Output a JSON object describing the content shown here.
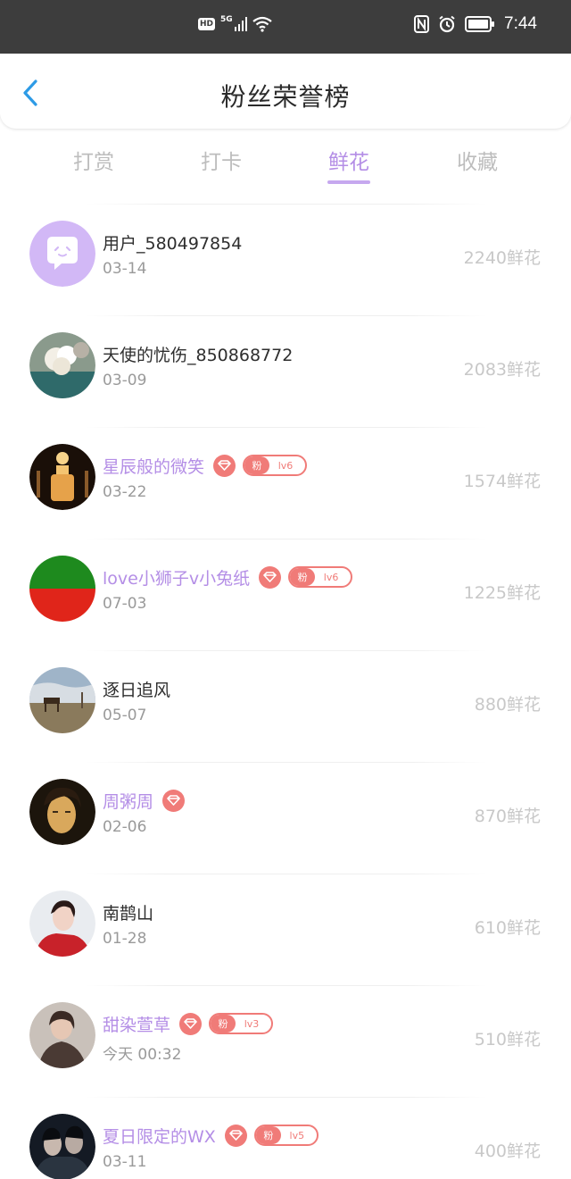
{
  "status_bar": {
    "hd": "HD",
    "signal": "5G",
    "time": "7:44"
  },
  "header": {
    "title": "粉丝荣誉榜",
    "back_icon": "chevron-left-icon"
  },
  "tabs": [
    {
      "label": "打赏",
      "active": false
    },
    {
      "label": "打卡",
      "active": false
    },
    {
      "label": "鲜花",
      "active": true
    },
    {
      "label": "收藏",
      "active": false
    }
  ],
  "colors": {
    "accent": "#b48ee6",
    "fan_badge": "#f07b78",
    "value_text": "#c8c8c8"
  },
  "rows": [
    {
      "name": "用户_580497854",
      "date": "03-14",
      "value": "2240鲜花",
      "fan": false
    },
    {
      "name": "天使的忧伤_850868772",
      "date": "03-09",
      "value": "2083鲜花",
      "fan": false
    },
    {
      "name": "星辰般的微笑",
      "date": "03-22",
      "value": "1574鲜花",
      "fan": true,
      "badge_char": "粉",
      "level": "lv6"
    },
    {
      "name": "love小狮子v小兔纸",
      "date": "07-03",
      "value": "1225鲜花",
      "fan": true,
      "badge_char": "粉",
      "level": "lv6"
    },
    {
      "name": "逐日追风",
      "date": "05-07",
      "value": "880鲜花",
      "fan": false
    },
    {
      "name": "周粥周",
      "date": "02-06",
      "value": "870鲜花",
      "fan": true
    },
    {
      "name": "南鹊山",
      "date": "01-28",
      "value": "610鲜花",
      "fan": false
    },
    {
      "name": "甜染萱草",
      "date": "今天 00:32",
      "value": "510鲜花",
      "fan": true,
      "badge_char": "粉",
      "level": "lv3"
    },
    {
      "name": "夏日限定的WX",
      "date": "03-11",
      "value": "400鲜花",
      "fan": true,
      "badge_char": "粉",
      "level": "lv5"
    }
  ]
}
